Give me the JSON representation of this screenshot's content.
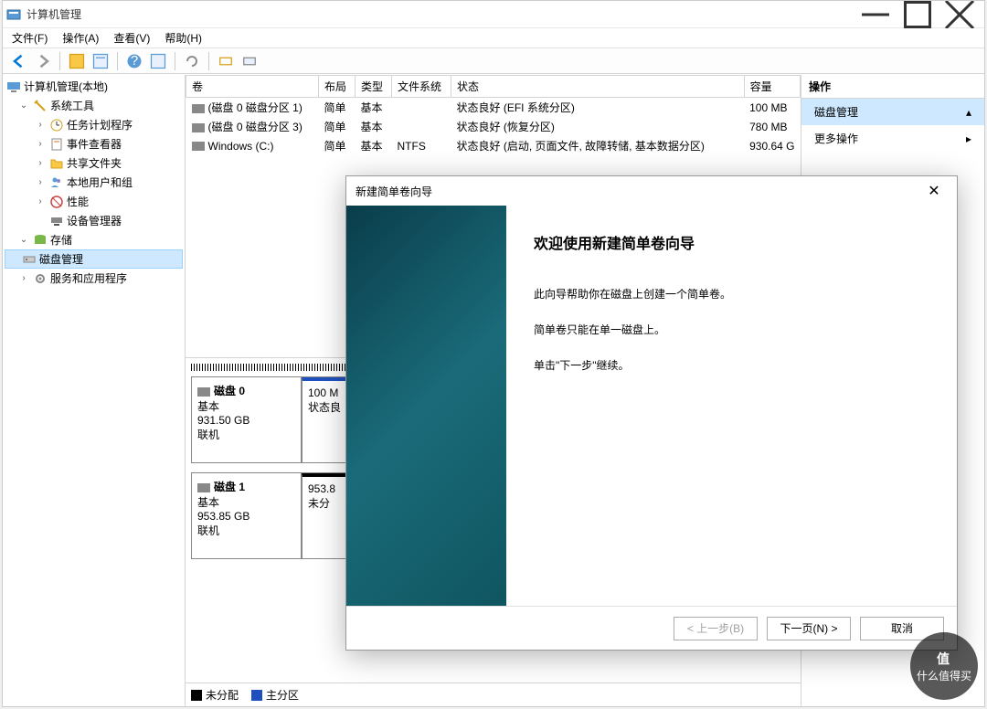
{
  "titlebar": {
    "title": "计算机管理"
  },
  "menubar": [
    "文件(F)",
    "操作(A)",
    "查看(V)",
    "帮助(H)"
  ],
  "tree": {
    "root": "计算机管理(本地)",
    "system_tools": "系统工具",
    "task_scheduler": "任务计划程序",
    "event_viewer": "事件查看器",
    "shared_folders": "共享文件夹",
    "local_users": "本地用户和组",
    "performance": "性能",
    "device_manager": "设备管理器",
    "storage": "存储",
    "disk_management": "磁盘管理",
    "services": "服务和应用程序"
  },
  "table": {
    "headers": {
      "volume": "卷",
      "layout": "布局",
      "type": "类型",
      "fs": "文件系统",
      "status": "状态",
      "capacity": "容量"
    },
    "rows": [
      {
        "volume": "(磁盘 0 磁盘分区 1)",
        "layout": "简单",
        "type": "基本",
        "fs": "",
        "status": "状态良好 (EFI 系统分区)",
        "capacity": "100 MB"
      },
      {
        "volume": "(磁盘 0 磁盘分区 3)",
        "layout": "简单",
        "type": "基本",
        "fs": "",
        "status": "状态良好 (恢复分区)",
        "capacity": "780 MB"
      },
      {
        "volume": "Windows (C:)",
        "layout": "简单",
        "type": "基本",
        "fs": "NTFS",
        "status": "状态良好 (启动, 页面文件, 故障转储, 基本数据分区)",
        "capacity": "930.64 G"
      }
    ]
  },
  "disks": [
    {
      "name": "磁盘 0",
      "type": "基本",
      "size": "931.50 GB",
      "status": "联机",
      "part": {
        "size": "100 M",
        "status": "状态良"
      }
    },
    {
      "name": "磁盘 1",
      "type": "基本",
      "size": "953.85 GB",
      "status": "联机",
      "part": {
        "size": "953.8",
        "status": "未分"
      }
    }
  ],
  "legend": {
    "unalloc": "未分配",
    "primary": "主分区"
  },
  "actions": {
    "header": "操作",
    "disk_mgmt": "磁盘管理",
    "more": "更多操作"
  },
  "dialog": {
    "title": "新建简单卷向导",
    "heading": "欢迎使用新建简单卷向导",
    "p1": "此向导帮助你在磁盘上创建一个简单卷。",
    "p2": "简单卷只能在单一磁盘上。",
    "p3": "单击\"下一步\"继续。",
    "back": "< 上一步(B)",
    "next": "下一页(N) >",
    "cancel": "取消"
  },
  "watermark": {
    "top": "值",
    "bottom": "什么值得买"
  }
}
